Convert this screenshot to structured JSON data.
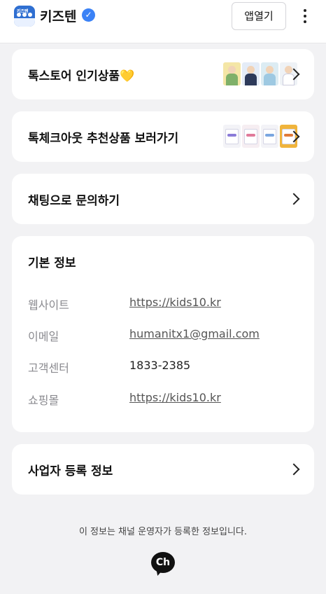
{
  "header": {
    "brand_name": "키즈텐",
    "logo_text": "키즈텐",
    "verified_mark": "✓",
    "app_button_label": "앱열기"
  },
  "cards": [
    {
      "label": "톡스토어 인기상품",
      "emoji": "💛"
    },
    {
      "label": "톡체크아웃 추천상품 보러가기"
    },
    {
      "label": "채팅으로 문의하기"
    }
  ],
  "basic_info": {
    "title": "기본 정보",
    "rows": [
      {
        "label": "웹사이트",
        "value": "https://kids10.kr"
      },
      {
        "label": "이메일",
        "value": "humanitx1@gmail.com"
      },
      {
        "label": "고객센터",
        "value": "1833-2385"
      },
      {
        "label": "쇼핑몰",
        "value": "https://kids10.kr"
      }
    ]
  },
  "business_info": {
    "label": "사업자 등록 정보"
  },
  "footer": {
    "note": "이 정보는 채널 운영자가 등록한 정보입니다.",
    "badge_text": "Ch"
  },
  "colors": {
    "background": "#f2f2f4",
    "card": "#ffffff",
    "verified": "#3b82f6",
    "heart": "#f5c518"
  },
  "icons": {
    "verified": "verified-badge-icon",
    "menu": "more-vertical-icon",
    "chevron": "chevron-right-icon",
    "channel": "kakao-channel-icon"
  }
}
